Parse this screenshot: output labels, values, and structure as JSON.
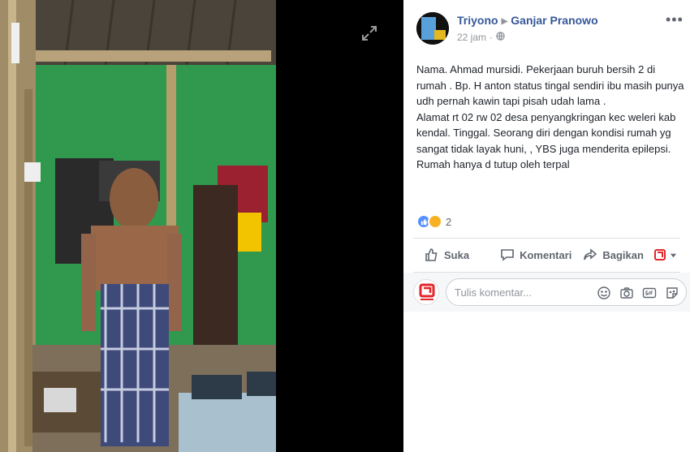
{
  "viewer": {
    "expand_icon": "expand-icon"
  },
  "post": {
    "author": "Triyono",
    "target": "Ganjar Pranowo",
    "time": "22 jam",
    "audience_icon": "globe-icon",
    "text": "Nama. Ahmad mursidi. Pekerjaan buruh bersih 2 di rumah . Bp. H anton status tingal sendiri ibu masih punya udh pernah kawin tapi pisah udah lama .\nAlamat rt 02 rw 02 desa penyangkringan kec weleri kab kendal. Tinggal. Seorang diri dengan kondisi rumah yg sangat tidak layak huni, , YBS juga menderita epilepsi.\nRumah hanya d tutup oleh terpal"
  },
  "reactions": {
    "types": [
      "like",
      "sad"
    ],
    "count": "2"
  },
  "actions": {
    "like": "Suka",
    "comment": "Komentari",
    "share": "Bagikan"
  },
  "comment_box": {
    "placeholder": "Tulis komentar..."
  },
  "colors": {
    "link": "#365899",
    "like_blue": "#5890ff",
    "sad_yellow": "#f7b125",
    "brand_red": "#e3262b"
  }
}
